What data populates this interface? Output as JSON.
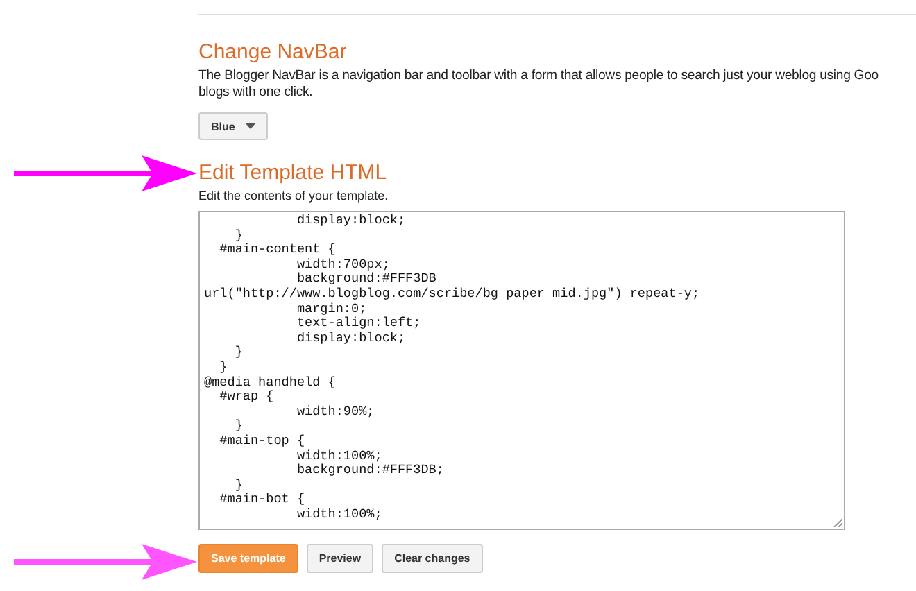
{
  "navbar_section": {
    "title": "Change NavBar",
    "description": "The Blogger NavBar is a navigation bar and toolbar with a form that allows people to search just your weblog using Goo\nblogs with one click.",
    "dropdown": {
      "value": "Blue"
    }
  },
  "template_section": {
    "title": "Edit Template HTML",
    "description": "Edit the contents of your template.",
    "code_lines": [
      "            display:block;",
      "    }",
      "  #main-content {",
      "            width:700px;",
      "            background:#FFF3DB",
      "url(\"http://www.blogblog.com/scribe/bg_paper_mid.jpg\") repeat-y;",
      "            margin:0;",
      "            text-align:left;",
      "            display:block;",
      "    }",
      "  }",
      "@media handheld {",
      "  #wrap {",
      "            width:90%;",
      "    }",
      "  #main-top {",
      "            width:100%;",
      "            background:#FFF3DB;",
      "    }",
      "  #main-bot {",
      "            width:100%;"
    ]
  },
  "buttons": [
    {
      "label": "Save template",
      "kind": "primary"
    },
    {
      "label": "Preview",
      "kind": "default"
    },
    {
      "label": "Clear changes",
      "kind": "default"
    }
  ]
}
